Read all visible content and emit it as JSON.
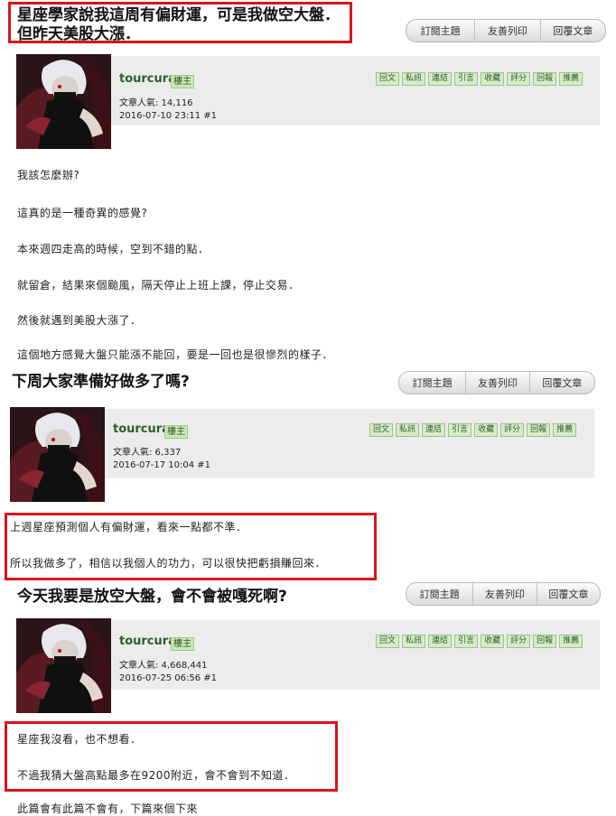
{
  "buttons": {
    "subscribe": "訂閱主題",
    "print": "友善列印",
    "reply": "回覆文章"
  },
  "actions": [
    "回文",
    "私訊",
    "連結",
    "引言",
    "收藏",
    "評分",
    "回報",
    "推薦"
  ],
  "posts": [
    {
      "title_line1": "星座學家說我這周有偏財運，可是我做空大盤．",
      "title_line2": "但昨天美股大漲．",
      "username": "tourcura",
      "badge": "樓主",
      "popularity": "文章人氣: 14,116",
      "datetime": "2016-07-10 23:11  #1",
      "paragraphs": [
        "我該怎麼辦?",
        "這真的是一種奇異的感覺?",
        "本來週四走高的時候，空到不錯的點．",
        "就留倉，結果來個颱風，隔天停止上班上課，停止交易．",
        "然後就遇到美股大漲了．",
        "這個地方感覺大盤只能漲不能回，要是一回也是很慘烈的樣子．"
      ]
    },
    {
      "title_line1": "下周大家準備好做多了嗎?",
      "username": "tourcura",
      "badge": "樓主",
      "popularity": "文章人氣: 6,337",
      "datetime": "2016-07-17 10:04  #1",
      "paragraphs": [
        "上週星座預測個人有偏財運，看來一點都不準．",
        "所以我做多了，相信以我個人的功力，可以很快把虧損賺回來．"
      ]
    },
    {
      "title_line1": "今天我要是放空大盤，會不會被嘎死啊?",
      "username": "tourcura",
      "badge": "樓主",
      "popularity": "文章人氣: 4,668,441",
      "datetime": "2016-07-25 06:56  #1",
      "paragraphs": [
        "星座我沒看，也不想看．",
        "不過我猜大盤高點最多在9200附近，會不會到不知道．",
        "此篇會有此篇不會有，下篇來個下來"
      ]
    }
  ]
}
